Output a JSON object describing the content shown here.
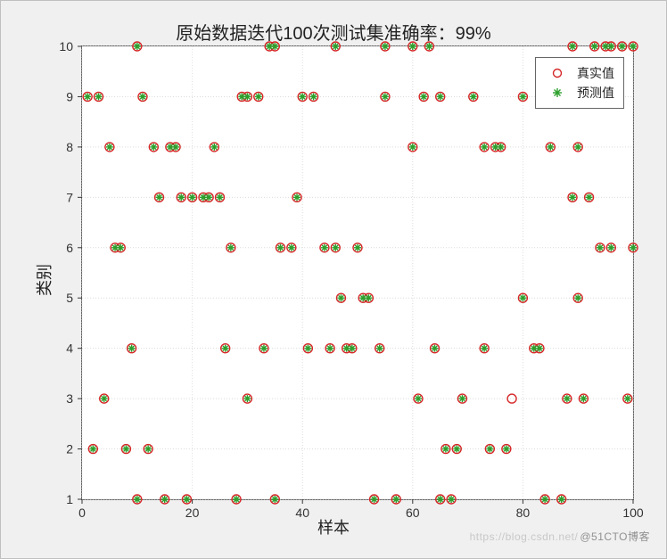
{
  "chart_data": {
    "type": "scatter",
    "title": "原始数据迭代100次测试集准确率：99%",
    "xlabel": "样本",
    "ylabel": "类别",
    "xlim": [
      0,
      100
    ],
    "ylim": [
      1,
      10
    ],
    "xticks": [
      0,
      20,
      40,
      60,
      80,
      100
    ],
    "yticks": [
      1,
      2,
      3,
      4,
      5,
      6,
      7,
      8,
      9,
      10
    ],
    "legend": {
      "position": "top-right",
      "entries": [
        "真实值",
        "预测值"
      ]
    },
    "series": [
      {
        "name": "真实值",
        "marker": "circle",
        "color": "#d62728",
        "points": [
          {
            "x": 1,
            "y": 9
          },
          {
            "x": 2,
            "y": 2
          },
          {
            "x": 3,
            "y": 9
          },
          {
            "x": 4,
            "y": 3
          },
          {
            "x": 5,
            "y": 8
          },
          {
            "x": 6,
            "y": 6
          },
          {
            "x": 7,
            "y": 6
          },
          {
            "x": 8,
            "y": 2
          },
          {
            "x": 9,
            "y": 4
          },
          {
            "x": 10,
            "y": 10
          },
          {
            "x": 10,
            "y": 1
          },
          {
            "x": 11,
            "y": 9
          },
          {
            "x": 12,
            "y": 2
          },
          {
            "x": 13,
            "y": 8
          },
          {
            "x": 14,
            "y": 7
          },
          {
            "x": 15,
            "y": 1
          },
          {
            "x": 16,
            "y": 8
          },
          {
            "x": 17,
            "y": 8
          },
          {
            "x": 18,
            "y": 7
          },
          {
            "x": 19,
            "y": 1
          },
          {
            "x": 20,
            "y": 7
          },
          {
            "x": 22,
            "y": 7
          },
          {
            "x": 23,
            "y": 7
          },
          {
            "x": 24,
            "y": 8
          },
          {
            "x": 25,
            "y": 7
          },
          {
            "x": 26,
            "y": 4
          },
          {
            "x": 27,
            "y": 6
          },
          {
            "x": 28,
            "y": 1
          },
          {
            "x": 29,
            "y": 9
          },
          {
            "x": 30,
            "y": 3
          },
          {
            "x": 30,
            "y": 9
          },
          {
            "x": 32,
            "y": 9
          },
          {
            "x": 33,
            "y": 4
          },
          {
            "x": 34,
            "y": 10
          },
          {
            "x": 35,
            "y": 1
          },
          {
            "x": 35,
            "y": 10
          },
          {
            "x": 36,
            "y": 6
          },
          {
            "x": 38,
            "y": 6
          },
          {
            "x": 39,
            "y": 7
          },
          {
            "x": 40,
            "y": 9
          },
          {
            "x": 41,
            "y": 4
          },
          {
            "x": 42,
            "y": 9
          },
          {
            "x": 44,
            "y": 6
          },
          {
            "x": 45,
            "y": 4
          },
          {
            "x": 46,
            "y": 6
          },
          {
            "x": 46,
            "y": 10
          },
          {
            "x": 47,
            "y": 5
          },
          {
            "x": 48,
            "y": 4
          },
          {
            "x": 49,
            "y": 4
          },
          {
            "x": 50,
            "y": 6
          },
          {
            "x": 51,
            "y": 5
          },
          {
            "x": 52,
            "y": 5
          },
          {
            "x": 53,
            "y": 1
          },
          {
            "x": 54,
            "y": 4
          },
          {
            "x": 55,
            "y": 10
          },
          {
            "x": 55,
            "y": 9
          },
          {
            "x": 57,
            "y": 1
          },
          {
            "x": 60,
            "y": 8
          },
          {
            "x": 60,
            "y": 10
          },
          {
            "x": 61,
            "y": 3
          },
          {
            "x": 62,
            "y": 9
          },
          {
            "x": 63,
            "y": 10
          },
          {
            "x": 64,
            "y": 4
          },
          {
            "x": 65,
            "y": 9
          },
          {
            "x": 65,
            "y": 1
          },
          {
            "x": 66,
            "y": 2
          },
          {
            "x": 67,
            "y": 1
          },
          {
            "x": 68,
            "y": 2
          },
          {
            "x": 69,
            "y": 3
          },
          {
            "x": 71,
            "y": 9
          },
          {
            "x": 73,
            "y": 8
          },
          {
            "x": 73,
            "y": 4
          },
          {
            "x": 74,
            "y": 2
          },
          {
            "x": 75,
            "y": 8
          },
          {
            "x": 76,
            "y": 8
          },
          {
            "x": 77,
            "y": 2
          },
          {
            "x": 78,
            "y": 3
          },
          {
            "x": 80,
            "y": 9
          },
          {
            "x": 80,
            "y": 5
          },
          {
            "x": 82,
            "y": 4
          },
          {
            "x": 83,
            "y": 4
          },
          {
            "x": 84,
            "y": 1
          },
          {
            "x": 85,
            "y": 8
          },
          {
            "x": 87,
            "y": 1
          },
          {
            "x": 88,
            "y": 3
          },
          {
            "x": 89,
            "y": 10
          },
          {
            "x": 89,
            "y": 7
          },
          {
            "x": 90,
            "y": 5
          },
          {
            "x": 90,
            "y": 8
          },
          {
            "x": 91,
            "y": 3
          },
          {
            "x": 92,
            "y": 7
          },
          {
            "x": 93,
            "y": 10
          },
          {
            "x": 94,
            "y": 6
          },
          {
            "x": 95,
            "y": 10
          },
          {
            "x": 96,
            "y": 10
          },
          {
            "x": 96,
            "y": 6
          },
          {
            "x": 98,
            "y": 10
          },
          {
            "x": 99,
            "y": 3
          },
          {
            "x": 100,
            "y": 6
          },
          {
            "x": 100,
            "y": 10
          }
        ]
      },
      {
        "name": "预测值",
        "marker": "asterisk",
        "color": "#2ca02c",
        "points": [
          {
            "x": 1,
            "y": 9
          },
          {
            "x": 2,
            "y": 2
          },
          {
            "x": 3,
            "y": 9
          },
          {
            "x": 4,
            "y": 3
          },
          {
            "x": 5,
            "y": 8
          },
          {
            "x": 6,
            "y": 6
          },
          {
            "x": 7,
            "y": 6
          },
          {
            "x": 8,
            "y": 2
          },
          {
            "x": 9,
            "y": 4
          },
          {
            "x": 10,
            "y": 10
          },
          {
            "x": 10,
            "y": 1
          },
          {
            "x": 11,
            "y": 9
          },
          {
            "x": 12,
            "y": 2
          },
          {
            "x": 13,
            "y": 8
          },
          {
            "x": 14,
            "y": 7
          },
          {
            "x": 15,
            "y": 1
          },
          {
            "x": 16,
            "y": 8
          },
          {
            "x": 17,
            "y": 8
          },
          {
            "x": 18,
            "y": 7
          },
          {
            "x": 19,
            "y": 1
          },
          {
            "x": 20,
            "y": 7
          },
          {
            "x": 22,
            "y": 7
          },
          {
            "x": 23,
            "y": 7
          },
          {
            "x": 24,
            "y": 8
          },
          {
            "x": 25,
            "y": 7
          },
          {
            "x": 26,
            "y": 4
          },
          {
            "x": 27,
            "y": 6
          },
          {
            "x": 28,
            "y": 1
          },
          {
            "x": 29,
            "y": 9
          },
          {
            "x": 30,
            "y": 3
          },
          {
            "x": 30,
            "y": 9
          },
          {
            "x": 32,
            "y": 9
          },
          {
            "x": 33,
            "y": 4
          },
          {
            "x": 34,
            "y": 10
          },
          {
            "x": 35,
            "y": 1
          },
          {
            "x": 35,
            "y": 10
          },
          {
            "x": 36,
            "y": 6
          },
          {
            "x": 38,
            "y": 6
          },
          {
            "x": 39,
            "y": 7
          },
          {
            "x": 40,
            "y": 9
          },
          {
            "x": 41,
            "y": 4
          },
          {
            "x": 42,
            "y": 9
          },
          {
            "x": 44,
            "y": 6
          },
          {
            "x": 45,
            "y": 4
          },
          {
            "x": 46,
            "y": 6
          },
          {
            "x": 46,
            "y": 10
          },
          {
            "x": 47,
            "y": 5
          },
          {
            "x": 48,
            "y": 4
          },
          {
            "x": 49,
            "y": 4
          },
          {
            "x": 50,
            "y": 6
          },
          {
            "x": 51,
            "y": 5
          },
          {
            "x": 52,
            "y": 5
          },
          {
            "x": 53,
            "y": 1
          },
          {
            "x": 54,
            "y": 4
          },
          {
            "x": 55,
            "y": 10
          },
          {
            "x": 55,
            "y": 9
          },
          {
            "x": 57,
            "y": 1
          },
          {
            "x": 60,
            "y": 8
          },
          {
            "x": 60,
            "y": 10
          },
          {
            "x": 61,
            "y": 3
          },
          {
            "x": 62,
            "y": 9
          },
          {
            "x": 63,
            "y": 10
          },
          {
            "x": 64,
            "y": 4
          },
          {
            "x": 65,
            "y": 9
          },
          {
            "x": 65,
            "y": 1
          },
          {
            "x": 66,
            "y": 2
          },
          {
            "x": 67,
            "y": 1
          },
          {
            "x": 68,
            "y": 2
          },
          {
            "x": 69,
            "y": 3
          },
          {
            "x": 71,
            "y": 9
          },
          {
            "x": 73,
            "y": 8
          },
          {
            "x": 73,
            "y": 4
          },
          {
            "x": 74,
            "y": 2
          },
          {
            "x": 75,
            "y": 8
          },
          {
            "x": 76,
            "y": 8
          },
          {
            "x": 77,
            "y": 2
          },
          {
            "x": 80,
            "y": 9
          },
          {
            "x": 80,
            "y": 5
          },
          {
            "x": 82,
            "y": 4
          },
          {
            "x": 83,
            "y": 4
          },
          {
            "x": 84,
            "y": 1
          },
          {
            "x": 85,
            "y": 8
          },
          {
            "x": 87,
            "y": 1
          },
          {
            "x": 88,
            "y": 3
          },
          {
            "x": 89,
            "y": 10
          },
          {
            "x": 89,
            "y": 7
          },
          {
            "x": 90,
            "y": 5
          },
          {
            "x": 90,
            "y": 8
          },
          {
            "x": 91,
            "y": 3
          },
          {
            "x": 92,
            "y": 7
          },
          {
            "x": 93,
            "y": 10
          },
          {
            "x": 94,
            "y": 6
          },
          {
            "x": 95,
            "y": 10
          },
          {
            "x": 96,
            "y": 10
          },
          {
            "x": 96,
            "y": 6
          },
          {
            "x": 98,
            "y": 10
          },
          {
            "x": 99,
            "y": 3
          },
          {
            "x": 100,
            "y": 6
          },
          {
            "x": 100,
            "y": 10
          }
        ]
      }
    ],
    "grid": true
  },
  "watermark": {
    "faint": "https://blog.csdn.net/",
    "text": "@51CTO博客"
  }
}
